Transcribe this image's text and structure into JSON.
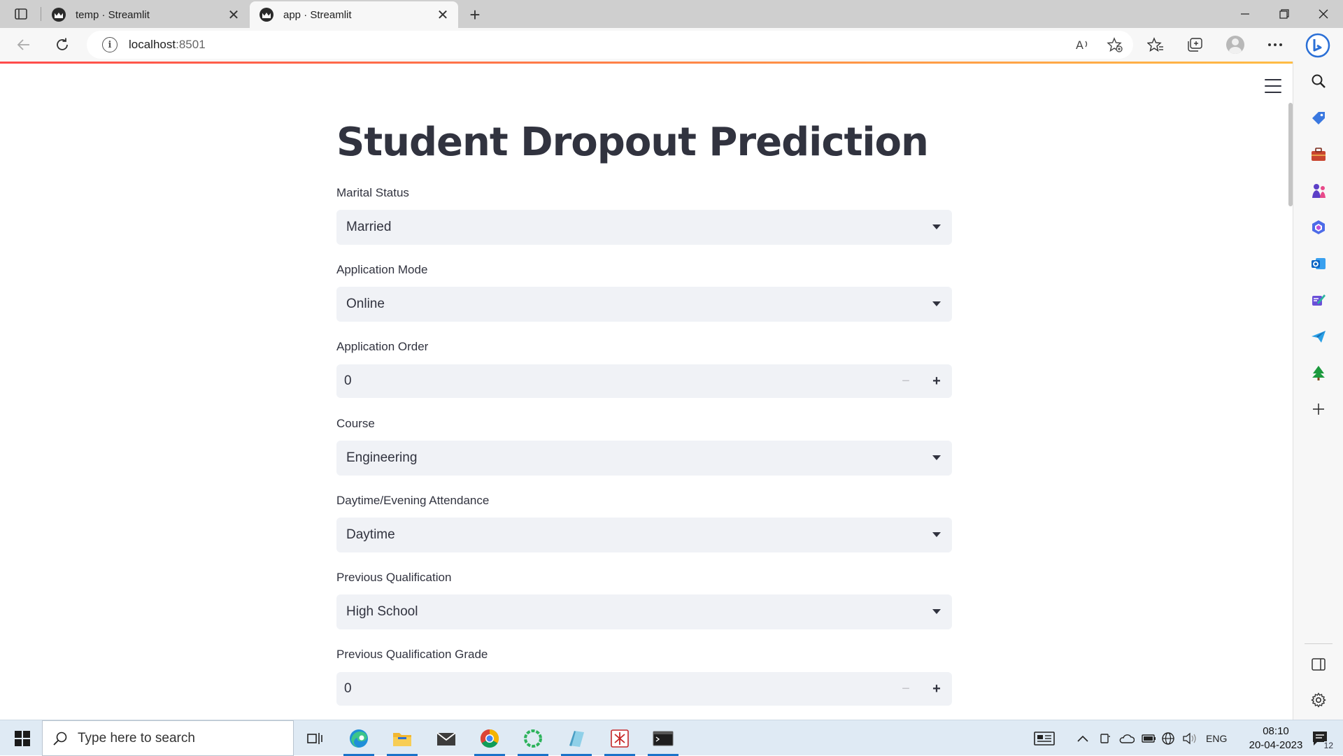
{
  "browser": {
    "tabs": [
      {
        "title": "temp · Streamlit",
        "active": false
      },
      {
        "title": "app · Streamlit",
        "active": true
      }
    ],
    "url_host": "localhost",
    "url_port": ":8501"
  },
  "app": {
    "title": "Student Dropout Prediction",
    "fields": [
      {
        "label": "Marital Status",
        "type": "select",
        "value": "Married"
      },
      {
        "label": "Application Mode",
        "type": "select",
        "value": "Online"
      },
      {
        "label": "Application Order",
        "type": "number",
        "value": "0"
      },
      {
        "label": "Course",
        "type": "select",
        "value": "Engineering"
      },
      {
        "label": "Daytime/Evening Attendance",
        "type": "select",
        "value": "Daytime"
      },
      {
        "label": "Previous Qualification",
        "type": "select",
        "value": "High School"
      },
      {
        "label": "Previous Qualification Grade",
        "type": "number",
        "value": "0"
      }
    ]
  },
  "taskbar": {
    "search_placeholder": "Type here to search",
    "language": "ENG",
    "time": "08:10",
    "date": "20-04-2023",
    "notification_count": "12"
  },
  "colors": {
    "accent_gradient_start": "#ff4b4b",
    "accent_gradient_end": "#ffbd45",
    "input_background": "#f0f2f6",
    "text": "#31333f"
  }
}
